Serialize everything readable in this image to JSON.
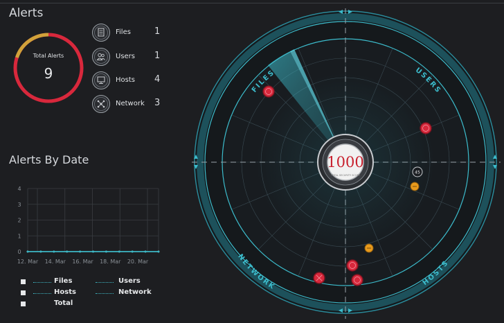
{
  "header": {
    "title": "Alerts"
  },
  "total": {
    "label": "Total Alerts",
    "value": "9"
  },
  "categories": [
    {
      "name": "Files",
      "count": "1",
      "icon": "file-icon"
    },
    {
      "name": "Users",
      "count": "1",
      "icon": "users-icon"
    },
    {
      "name": "Hosts",
      "count": "4",
      "icon": "monitor-icon"
    },
    {
      "name": "Network",
      "count": "3",
      "icon": "network-icon"
    }
  ],
  "by_date": {
    "title": "Alerts By Date"
  },
  "chart_data": {
    "type": "line",
    "categories": [
      "12. Mar",
      "14. Mar",
      "16. Mar",
      "18. Mar",
      "20. Mar"
    ],
    "yticks": [
      "0",
      "1",
      "2",
      "3",
      "4"
    ],
    "ylim": [
      0,
      4
    ],
    "series": [
      {
        "name": "Files",
        "values": [
          0,
          0,
          0,
          0,
          0
        ]
      },
      {
        "name": "Users",
        "values": [
          0,
          0,
          0,
          0,
          0
        ]
      },
      {
        "name": "Hosts",
        "values": [
          0,
          0,
          0,
          0,
          0
        ]
      },
      {
        "name": "Network",
        "values": [
          0,
          0,
          0,
          0,
          0
        ]
      },
      {
        "name": "Total",
        "values": [
          0,
          0,
          0,
          0,
          0
        ]
      }
    ],
    "grid": true,
    "legend": "bottom"
  },
  "legend": {
    "files": "Files",
    "users": "Users",
    "hosts": "Hosts",
    "network": "Network",
    "total": "Total"
  },
  "radar": {
    "score": "1000",
    "score_caption": "TOTAL SECURITY SCORE",
    "quadrants": {
      "files": "FILES",
      "users": "USERS",
      "network": "NETWORK",
      "hosts": "HOSTS"
    },
    "badge": "45",
    "colors": {
      "critical": "#d8283c",
      "warning": "#e89a1c",
      "accent": "#2fb3c4",
      "score": "#c8202e"
    }
  },
  "colors": {
    "ring_red": "#d8283c",
    "ring_gold": "#d1a23a",
    "line": "#3fb7c4"
  }
}
